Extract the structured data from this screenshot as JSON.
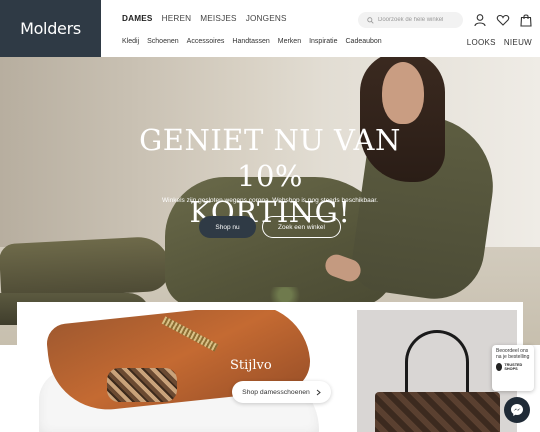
{
  "brand": {
    "logo": "Molders"
  },
  "main_nav": [
    "DAMES",
    "HEREN",
    "MEISJES",
    "JONGENS"
  ],
  "sub_nav": [
    "Kledij",
    "Schoenen",
    "Accessoires",
    "Handtassen",
    "Merken",
    "Inspiratie",
    "Cadeaubon"
  ],
  "right_nav": [
    "LOOKS",
    "NIEUW"
  ],
  "search": {
    "placeholder": "Doorzoek de hele winkel"
  },
  "icons": {
    "account": "user-icon",
    "wishlist": "heart-icon",
    "cart": "bag-icon",
    "search": "search-icon",
    "chat": "messenger-icon"
  },
  "hero": {
    "title_line1": "GENIET NU VAN 10%",
    "title_line2": "KORTING!",
    "subtitle": "Winkels zijn gesloten wegens corona. Webshop is nog steeds beschikbaar.",
    "primary_button": "Shop nu",
    "secondary_button": "Zoek een winkel"
  },
  "promo": {
    "card_title": "Stijlvo",
    "button": "Shop damesschoenen"
  },
  "review_badge": {
    "text": "Beoordeel ons na je bestelling",
    "logo_text": "TRUSTED SHOPS"
  },
  "colors": {
    "brand_dark": "#2f3a45"
  }
}
